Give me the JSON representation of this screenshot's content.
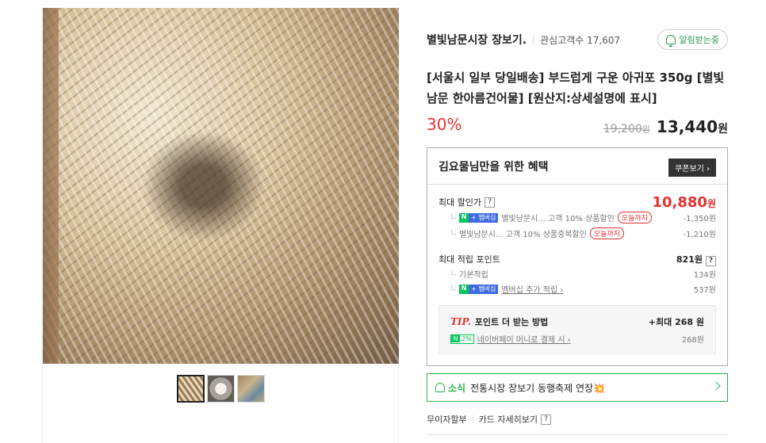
{
  "gallery": {
    "thumbnails": [
      "thumb-1",
      "thumb-2",
      "thumb-3"
    ]
  },
  "store": {
    "name": "별빛남문시장 장보기.",
    "followers_label": "관심고객수 17,607",
    "notify_label": "알림받는중"
  },
  "product": {
    "title": "[서울시 일부 당일배송] 부드럽게 구운 아귀포 350g [별빛남문 한아름건어물] [원산지:상세설명에 표시]",
    "discount": "30%",
    "original_price": "19,200",
    "original_unit": "원",
    "sale_price": "13,440",
    "sale_unit": "원"
  },
  "benefits": {
    "title": "김요물님만을 위한 혜택",
    "coupon_label": "쿠폰보기 ›",
    "max_discount_label": "최대 할인가",
    "max_discount_value": "10,880",
    "max_discount_unit": "원",
    "discount_rows": [
      {
        "text": "별빛남문시... 고객 10% 상품할인",
        "tag": "오늘까지",
        "amount": "-1,350원"
      },
      {
        "text": "별빛남문시... 고객 10% 상품중복할인",
        "tag": "오늘까지",
        "amount": "-1,210원"
      }
    ],
    "max_points_label": "최대 적립 포인트",
    "max_points_value": "821원",
    "point_rows": [
      {
        "text": "기본적립",
        "amount": "134원"
      },
      {
        "text": "멤버십 추가 적립 ›",
        "amount": "537원"
      }
    ],
    "badge_n": "N",
    "badge_plus": "+ 멤버십",
    "tip": {
      "label": "TIP.",
      "text": "포인트 더 받는 방법",
      "right": "+최대 268 원",
      "pct": "2%",
      "link": "네이버페이 머니로 결제 시 ›",
      "amount": "268원"
    }
  },
  "news": {
    "label": "소식",
    "text": "전통시장 장보기 동행축제 연장💥"
  },
  "bottom": {
    "installment": "무이자할부",
    "card_detail": "카드 자세히보기",
    "q": "?"
  }
}
